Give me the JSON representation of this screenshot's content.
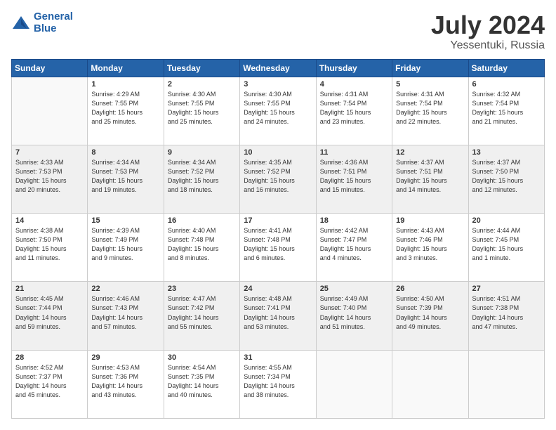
{
  "logo": {
    "line1": "General",
    "line2": "Blue"
  },
  "title": "July 2024",
  "subtitle": "Yessentuki, Russia",
  "headers": [
    "Sunday",
    "Monday",
    "Tuesday",
    "Wednesday",
    "Thursday",
    "Friday",
    "Saturday"
  ],
  "weeks": [
    [
      {
        "day": "",
        "info": ""
      },
      {
        "day": "1",
        "info": "Sunrise: 4:29 AM\nSunset: 7:55 PM\nDaylight: 15 hours\nand 25 minutes."
      },
      {
        "day": "2",
        "info": "Sunrise: 4:30 AM\nSunset: 7:55 PM\nDaylight: 15 hours\nand 25 minutes."
      },
      {
        "day": "3",
        "info": "Sunrise: 4:30 AM\nSunset: 7:55 PM\nDaylight: 15 hours\nand 24 minutes."
      },
      {
        "day": "4",
        "info": "Sunrise: 4:31 AM\nSunset: 7:54 PM\nDaylight: 15 hours\nand 23 minutes."
      },
      {
        "day": "5",
        "info": "Sunrise: 4:31 AM\nSunset: 7:54 PM\nDaylight: 15 hours\nand 22 minutes."
      },
      {
        "day": "6",
        "info": "Sunrise: 4:32 AM\nSunset: 7:54 PM\nDaylight: 15 hours\nand 21 minutes."
      }
    ],
    [
      {
        "day": "7",
        "info": "Sunrise: 4:33 AM\nSunset: 7:53 PM\nDaylight: 15 hours\nand 20 minutes."
      },
      {
        "day": "8",
        "info": "Sunrise: 4:34 AM\nSunset: 7:53 PM\nDaylight: 15 hours\nand 19 minutes."
      },
      {
        "day": "9",
        "info": "Sunrise: 4:34 AM\nSunset: 7:52 PM\nDaylight: 15 hours\nand 18 minutes."
      },
      {
        "day": "10",
        "info": "Sunrise: 4:35 AM\nSunset: 7:52 PM\nDaylight: 15 hours\nand 16 minutes."
      },
      {
        "day": "11",
        "info": "Sunrise: 4:36 AM\nSunset: 7:51 PM\nDaylight: 15 hours\nand 15 minutes."
      },
      {
        "day": "12",
        "info": "Sunrise: 4:37 AM\nSunset: 7:51 PM\nDaylight: 15 hours\nand 14 minutes."
      },
      {
        "day": "13",
        "info": "Sunrise: 4:37 AM\nSunset: 7:50 PM\nDaylight: 15 hours\nand 12 minutes."
      }
    ],
    [
      {
        "day": "14",
        "info": "Sunrise: 4:38 AM\nSunset: 7:50 PM\nDaylight: 15 hours\nand 11 minutes."
      },
      {
        "day": "15",
        "info": "Sunrise: 4:39 AM\nSunset: 7:49 PM\nDaylight: 15 hours\nand 9 minutes."
      },
      {
        "day": "16",
        "info": "Sunrise: 4:40 AM\nSunset: 7:48 PM\nDaylight: 15 hours\nand 8 minutes."
      },
      {
        "day": "17",
        "info": "Sunrise: 4:41 AM\nSunset: 7:48 PM\nDaylight: 15 hours\nand 6 minutes."
      },
      {
        "day": "18",
        "info": "Sunrise: 4:42 AM\nSunset: 7:47 PM\nDaylight: 15 hours\nand 4 minutes."
      },
      {
        "day": "19",
        "info": "Sunrise: 4:43 AM\nSunset: 7:46 PM\nDaylight: 15 hours\nand 3 minutes."
      },
      {
        "day": "20",
        "info": "Sunrise: 4:44 AM\nSunset: 7:45 PM\nDaylight: 15 hours\nand 1 minute."
      }
    ],
    [
      {
        "day": "21",
        "info": "Sunrise: 4:45 AM\nSunset: 7:44 PM\nDaylight: 14 hours\nand 59 minutes."
      },
      {
        "day": "22",
        "info": "Sunrise: 4:46 AM\nSunset: 7:43 PM\nDaylight: 14 hours\nand 57 minutes."
      },
      {
        "day": "23",
        "info": "Sunrise: 4:47 AM\nSunset: 7:42 PM\nDaylight: 14 hours\nand 55 minutes."
      },
      {
        "day": "24",
        "info": "Sunrise: 4:48 AM\nSunset: 7:41 PM\nDaylight: 14 hours\nand 53 minutes."
      },
      {
        "day": "25",
        "info": "Sunrise: 4:49 AM\nSunset: 7:40 PM\nDaylight: 14 hours\nand 51 minutes."
      },
      {
        "day": "26",
        "info": "Sunrise: 4:50 AM\nSunset: 7:39 PM\nDaylight: 14 hours\nand 49 minutes."
      },
      {
        "day": "27",
        "info": "Sunrise: 4:51 AM\nSunset: 7:38 PM\nDaylight: 14 hours\nand 47 minutes."
      }
    ],
    [
      {
        "day": "28",
        "info": "Sunrise: 4:52 AM\nSunset: 7:37 PM\nDaylight: 14 hours\nand 45 minutes."
      },
      {
        "day": "29",
        "info": "Sunrise: 4:53 AM\nSunset: 7:36 PM\nDaylight: 14 hours\nand 43 minutes."
      },
      {
        "day": "30",
        "info": "Sunrise: 4:54 AM\nSunset: 7:35 PM\nDaylight: 14 hours\nand 40 minutes."
      },
      {
        "day": "31",
        "info": "Sunrise: 4:55 AM\nSunset: 7:34 PM\nDaylight: 14 hours\nand 38 minutes."
      },
      {
        "day": "",
        "info": ""
      },
      {
        "day": "",
        "info": ""
      },
      {
        "day": "",
        "info": ""
      }
    ]
  ]
}
